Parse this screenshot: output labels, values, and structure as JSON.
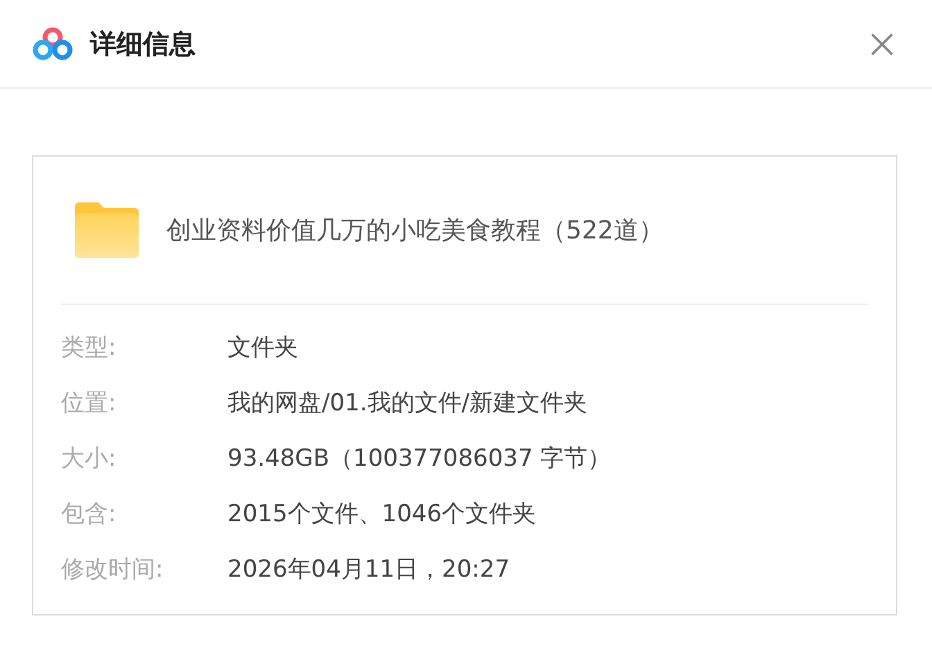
{
  "window": {
    "title": "详细信息"
  },
  "file": {
    "name": "创业资料价值几万的小吃美食教程（522道）"
  },
  "details": [
    {
      "label": "类型:",
      "value": "文件夹"
    },
    {
      "label": "位置:",
      "value": "我的网盘/01.我的文件/新建文件夹"
    },
    {
      "label": "大小:",
      "value": "93.48GB（100377086037 字节）"
    },
    {
      "label": "包含:",
      "value": "2015个文件、1046个文件夹"
    },
    {
      "label": "修改时间:",
      "value": "2026年04月11日，20:27"
    }
  ]
}
